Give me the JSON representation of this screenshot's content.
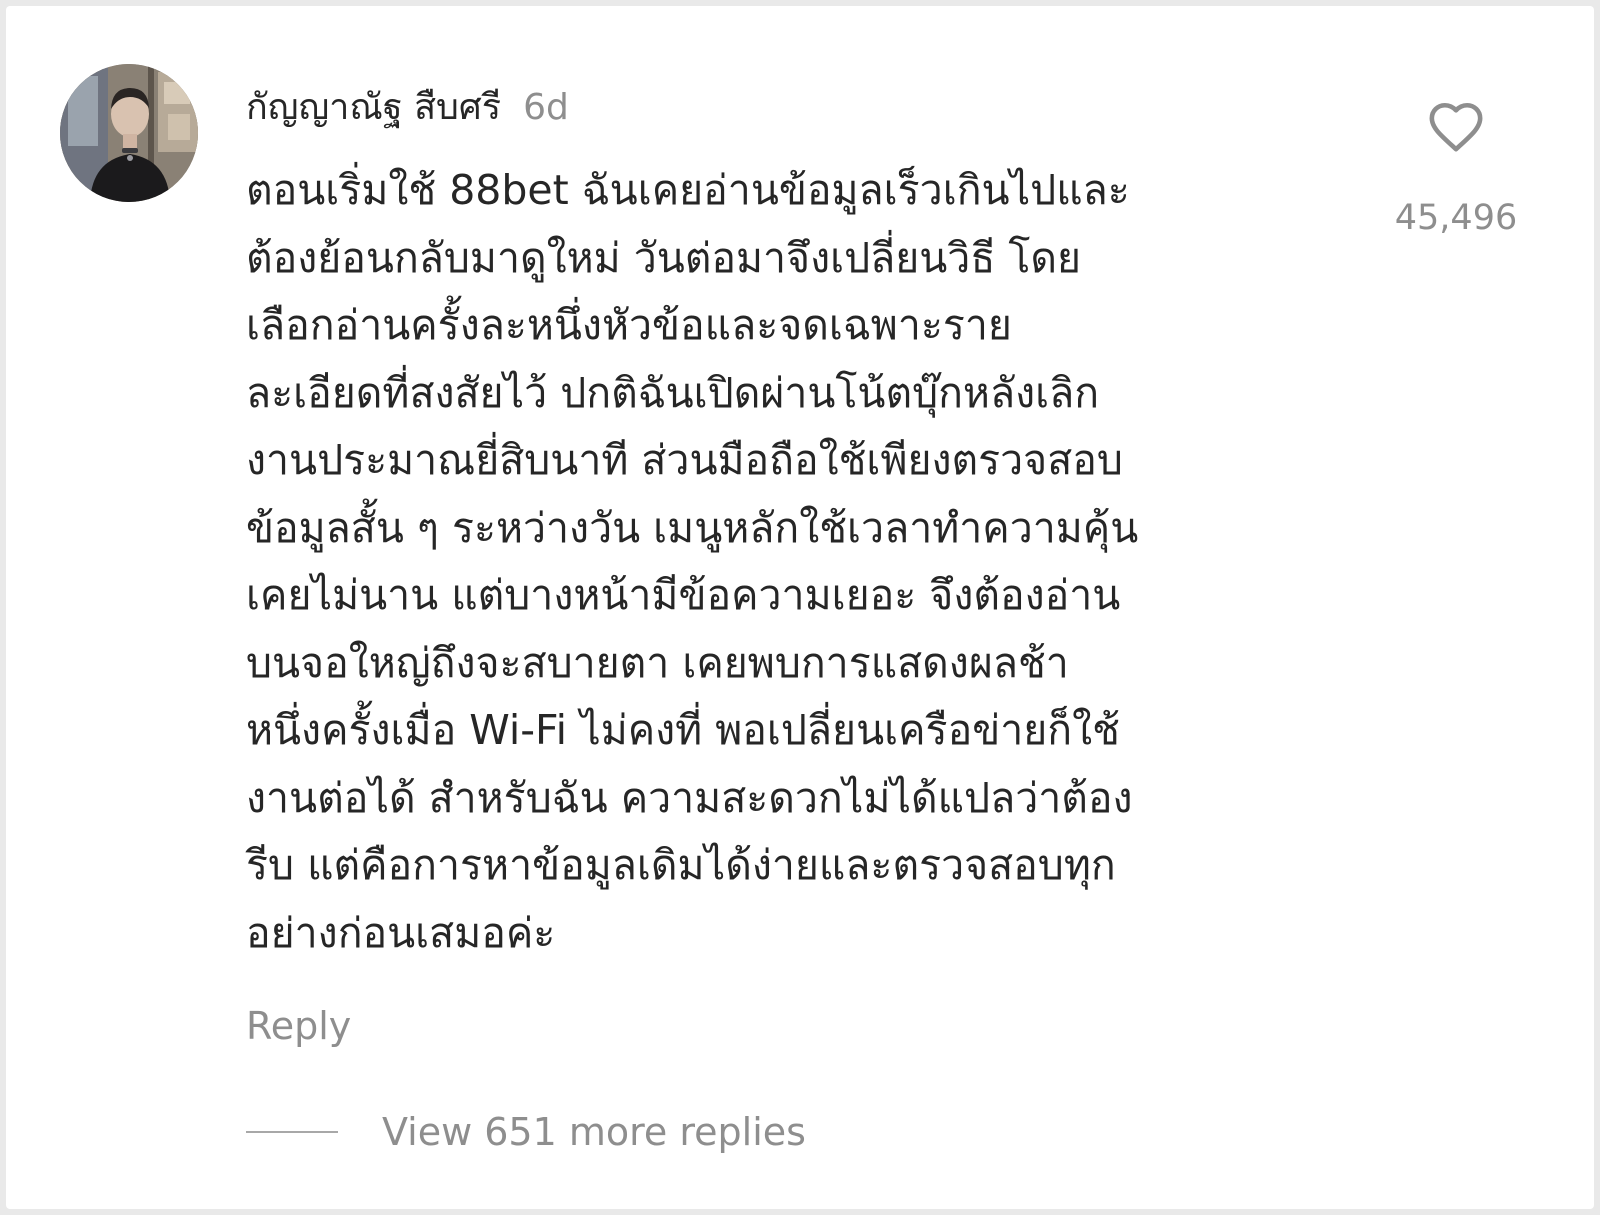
{
  "comment": {
    "username": "กัญญาณัฐ สืบศรี",
    "time": "6d",
    "lines": [
      "ตอนเริ่มใช้ 88bet ฉันเคยอ่านข้อมูลเร็วเกินไปและ",
      "ต้องย้อนกลับมาดูใหม่ วันต่อมาจึงเปลี่ยนวิธี โดย",
      "เลือกอ่านครั้งละหนึ่งหัวข้อและจดเฉพาะราย",
      "ละเอียดที่สงสัยไว้ ปกติฉันเปิดผ่านโน้ตบุ๊กหลังเลิก",
      "งานประมาณยี่สิบนาที ส่วนมือถือใช้เพียงตรวจสอบ",
      "ข้อมูลสั้น ๆ ระหว่างวัน เมนูหลักใช้เวลาทำความคุ้น",
      "เคยไม่นาน แต่บางหน้ามีข้อความเยอะ จึงต้องอ่าน",
      "บนจอใหญ่ถึงจะสบายตา เคยพบการแสดงผลช้า",
      "หนึ่งครั้งเมื่อ Wi-Fi ไม่คงที่ พอเปลี่ยนเครือข่ายก็ใช้",
      "งานต่อได้ สำหรับฉัน ความสะดวกไม่ได้แปลว่าต้อง",
      "รีบ แต่คือการหาข้อมูลเดิมได้ง่ายและตรวจสอบทุก",
      "อย่างก่อนเสมอค่ะ"
    ],
    "like_count": "45,496",
    "reply_label": "Reply",
    "view_replies_label": "View 651 more replies",
    "icons": {
      "like": "heart-outline-icon",
      "avatar": "user-avatar"
    },
    "colors": {
      "text": "#262626",
      "muted": "#8e8e8e"
    }
  }
}
